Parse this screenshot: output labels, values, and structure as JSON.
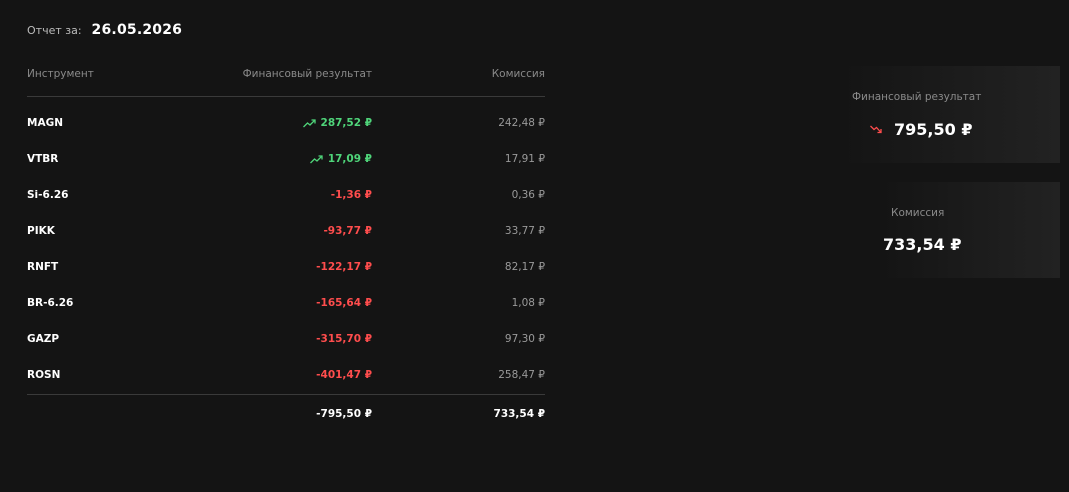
{
  "report": {
    "label": "Отчет за:",
    "date": "26.05.2026"
  },
  "table": {
    "headers": {
      "instrument": "Инструмент",
      "result": "Финансовый результат",
      "commission": "Комиссия"
    },
    "rows": [
      {
        "instrument": "MAGN",
        "result": "287,52 ₽",
        "commission": "242,48 ₽",
        "trend": "up"
      },
      {
        "instrument": "VTBR",
        "result": "17,09 ₽",
        "commission": "17,91 ₽",
        "trend": "up"
      },
      {
        "instrument": "Si-6.26",
        "result": "-1,36 ₽",
        "commission": "0,36 ₽",
        "trend": "none"
      },
      {
        "instrument": "PIKK",
        "result": "-93,77 ₽",
        "commission": "33,77 ₽",
        "trend": "none"
      },
      {
        "instrument": "RNFT",
        "result": "-122,17 ₽",
        "commission": "82,17 ₽",
        "trend": "none"
      },
      {
        "instrument": "BR-6.26",
        "result": "-165,64 ₽",
        "commission": "1,08 ₽",
        "trend": "none"
      },
      {
        "instrument": "GAZP",
        "result": "-315,70 ₽",
        "commission": "97,30 ₽",
        "trend": "none"
      },
      {
        "instrument": "ROSN",
        "result": "-401,47 ₽",
        "commission": "258,47 ₽",
        "trend": "none"
      }
    ],
    "totals": {
      "result": "-795,50 ₽",
      "commission": "733,54 ₽"
    }
  },
  "summary": {
    "result_label": "Финансовый результат",
    "result_value": "795,50 ₽",
    "result_trend": "down",
    "commission_label": "Комиссия",
    "commission_value": "733,54 ₽"
  },
  "colors": {
    "positive": "#4fd57a",
    "negative": "#ff4d4d",
    "background": "#141414"
  },
  "icons": {
    "trend_up": "trend-up-icon",
    "trend_down": "trend-down-icon"
  }
}
